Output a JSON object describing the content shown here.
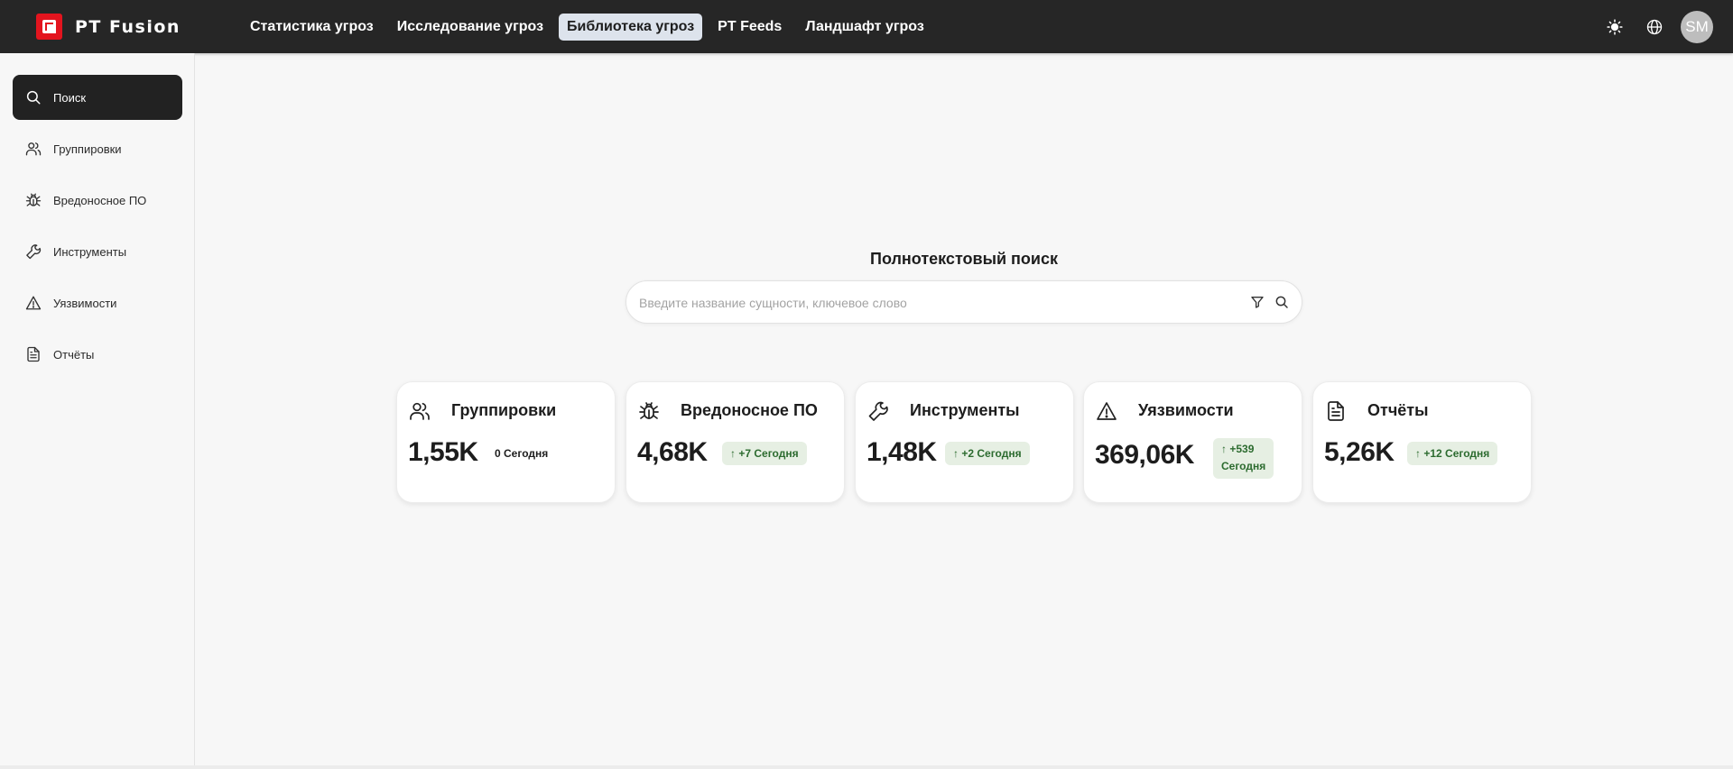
{
  "app": {
    "name": "PT Fusion"
  },
  "nav": {
    "items": [
      {
        "label": "Статистика угроз",
        "active": false
      },
      {
        "label": "Исследование угроз",
        "active": false
      },
      {
        "label": "Библиотека угроз",
        "active": true
      },
      {
        "label": "PT Feeds",
        "active": false
      },
      {
        "label": "Ландшафт угроз",
        "active": false
      }
    ]
  },
  "top_icons": {
    "theme": "sun-icon",
    "language": "globe-icon",
    "avatar_initials": "SM"
  },
  "sidebar": {
    "items": [
      {
        "label": "Поиск",
        "icon": "search-icon",
        "active": true
      },
      {
        "label": "Группировки",
        "icon": "users-icon",
        "active": false
      },
      {
        "label": "Вредоносное ПО",
        "icon": "bug-icon",
        "active": false
      },
      {
        "label": "Инструменты",
        "icon": "wrench-icon",
        "active": false
      },
      {
        "label": "Уязвимости",
        "icon": "warning-icon",
        "active": false
      },
      {
        "label": "Отчёты",
        "icon": "document-icon",
        "active": false
      }
    ]
  },
  "search": {
    "title": "Полнотекстовый поиск",
    "placeholder": "Введите название сущности, ключевое слово",
    "value": ""
  },
  "cards": [
    {
      "title": "Группировки",
      "value": "1,55K",
      "badge": "0 Сегодня",
      "icon": "users-icon"
    },
    {
      "title": "Вредоносное ПО",
      "value": "4,68K",
      "badge": "↑ +7 Сегодня",
      "icon": "bug-icon"
    },
    {
      "title": "Инструменты",
      "value": "1,48K",
      "badge": "↑ +2 Сегодня",
      "icon": "wrench-icon"
    },
    {
      "title": "Уязвимости",
      "value": "369,06K",
      "badge_line1": "↑ +539",
      "badge_line2": "Сегодня",
      "icon": "warning-icon"
    },
    {
      "title": "Отчёты",
      "value": "5,26K",
      "badge": "↑ +12 Сегодня",
      "icon": "document-icon"
    }
  ],
  "colors": {
    "topbar": "#262626",
    "accent_red": "#e3141e",
    "badge_bg": "#e6efe3",
    "badge_text": "#2c6b2f"
  }
}
